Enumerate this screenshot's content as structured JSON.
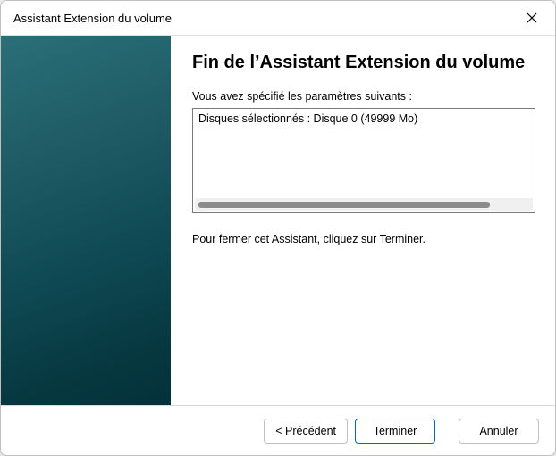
{
  "window": {
    "title": "Assistant Extension du volume"
  },
  "content": {
    "heading": "Fin de l’Assistant Extension du volume",
    "intro": "Vous avez spécifié les paramètres suivants :",
    "params": [
      "Disques sélectionnés : Disque 0 (49999 Mo)"
    ],
    "instruction": "Pour fermer cet Assistant, cliquez sur Terminer."
  },
  "footer": {
    "back": "< Précédent",
    "finish": "Terminer",
    "cancel": "Annuler"
  }
}
